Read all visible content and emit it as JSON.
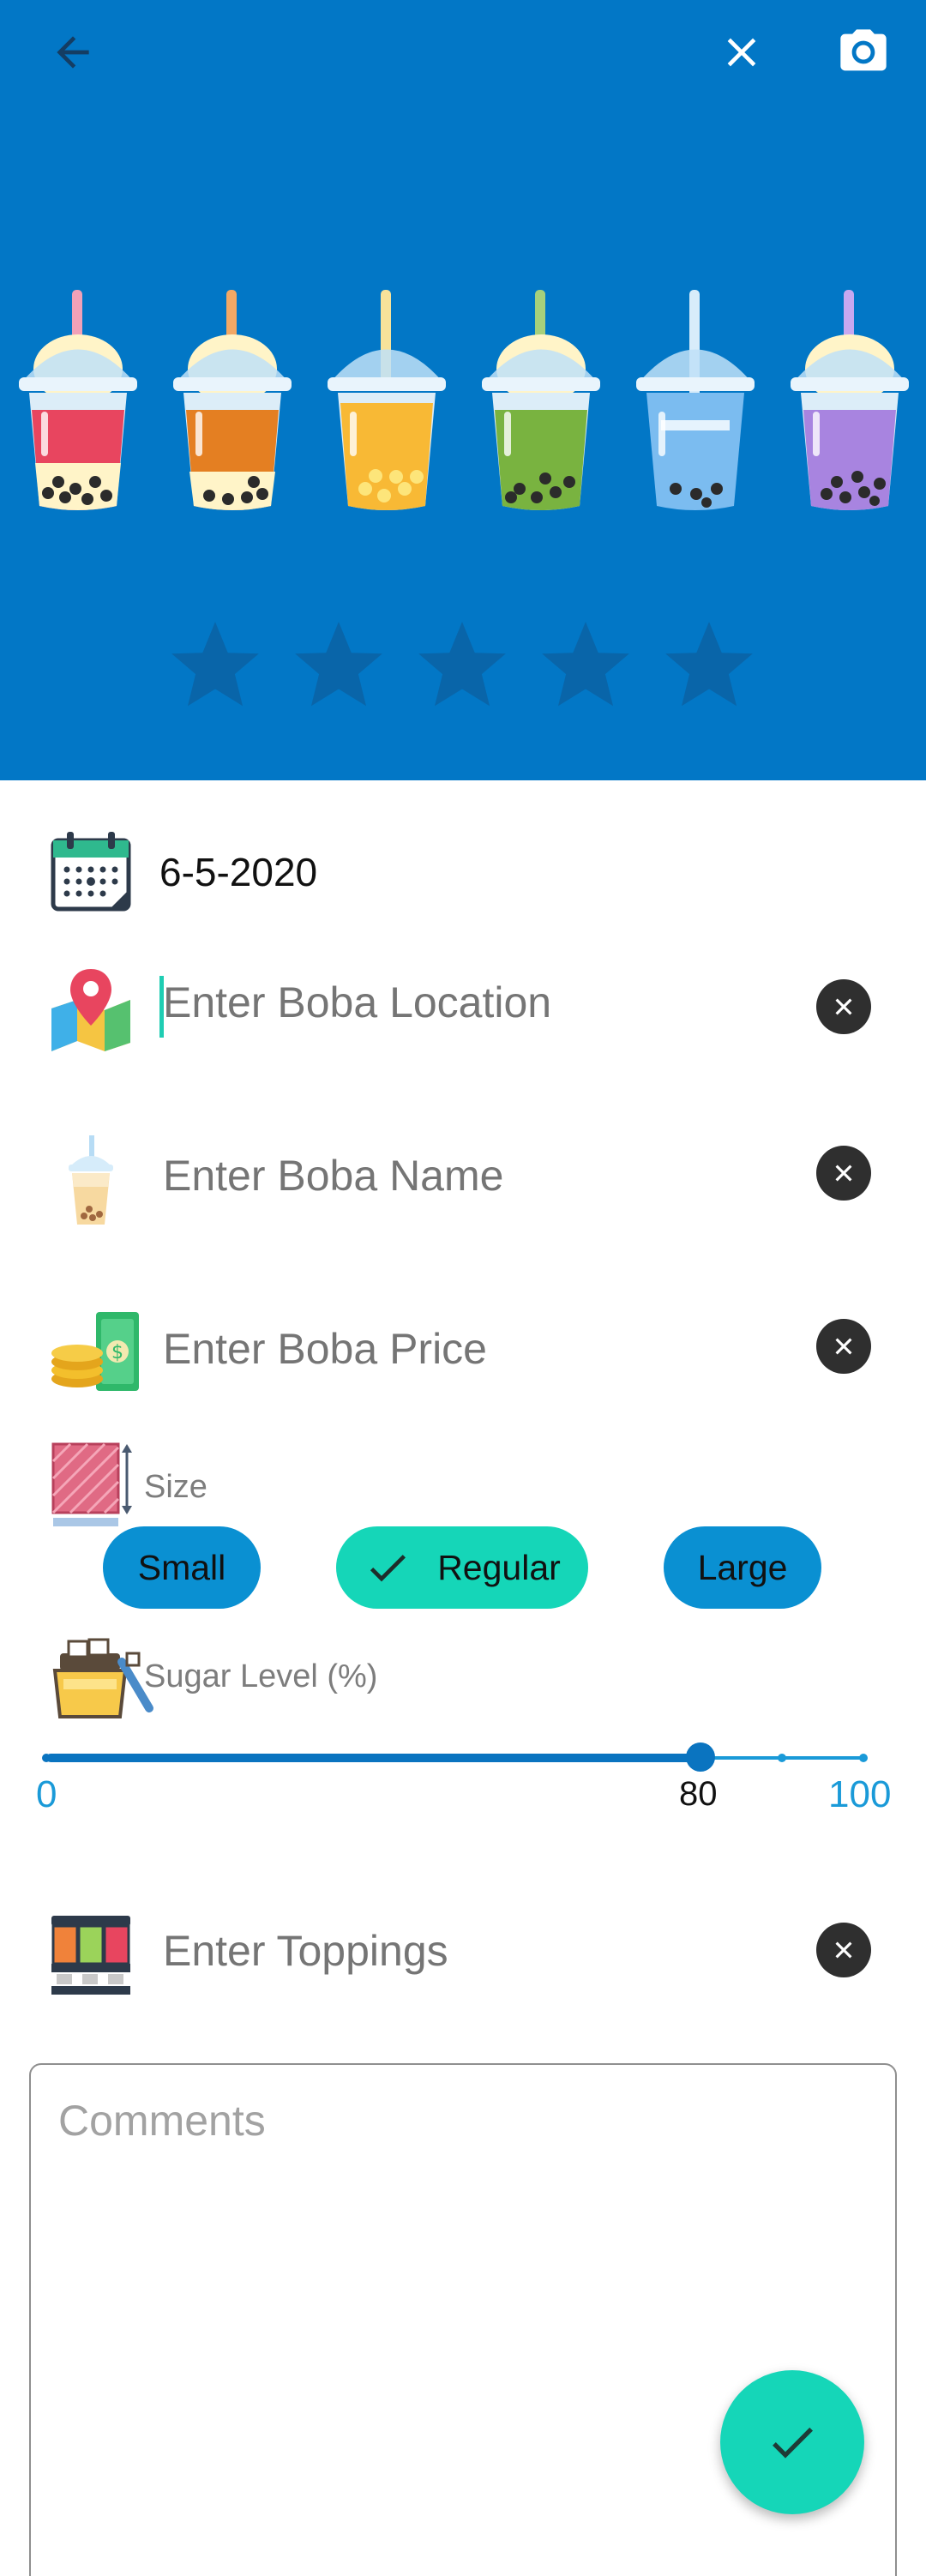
{
  "header": {
    "background": "#0277c6",
    "back_icon": "arrow-left-icon",
    "close_icon": "close-icon",
    "camera_icon": "camera-icon",
    "cup_colors": [
      "#e8455f",
      "#e47f22",
      "#f8b935",
      "#79b340",
      "#5aa8e6",
      "#a884e0"
    ],
    "rating": {
      "max": 5,
      "value": 0
    }
  },
  "form": {
    "date": "6-5-2020",
    "location": {
      "placeholder": "Enter Boba Location",
      "value": ""
    },
    "name": {
      "placeholder": "Enter Boba Name",
      "value": ""
    },
    "price": {
      "placeholder": "Enter Boba Price",
      "value": ""
    },
    "size": {
      "label": "Size",
      "options": [
        "Small",
        "Regular",
        "Large"
      ],
      "selected": "Regular"
    },
    "sugar": {
      "label": "Sugar Level (%)",
      "min": "0",
      "max": "100",
      "value": "80"
    },
    "toppings": {
      "placeholder": "Enter Toppings",
      "value": ""
    },
    "comments": {
      "placeholder": "Comments",
      "value": ""
    }
  },
  "fab": {
    "icon": "check-icon",
    "color": "#15d6b8"
  }
}
